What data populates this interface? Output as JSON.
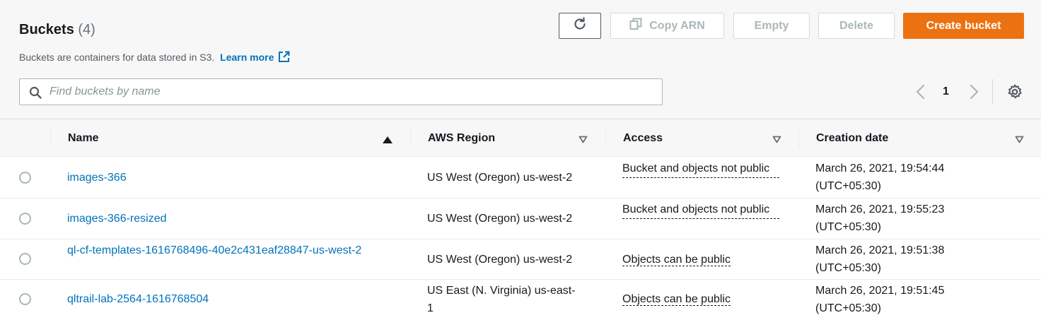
{
  "header": {
    "title": "Buckets",
    "count": "(4)",
    "description": "Buckets are containers for data stored in S3.",
    "learn_more": "Learn more"
  },
  "actions": {
    "copy_arn": "Copy ARN",
    "empty": "Empty",
    "delete": "Delete",
    "create_bucket": "Create bucket"
  },
  "search": {
    "placeholder": "Find buckets by name",
    "value": ""
  },
  "pagination": {
    "current_page": "1"
  },
  "table": {
    "columns": [
      "Name",
      "AWS Region",
      "Access",
      "Creation date"
    ],
    "rows": [
      {
        "name": "images-366",
        "region": "US West (Oregon) us-west-2",
        "access": "Bucket and objects not public",
        "created": "March 26, 2021, 19:54:44",
        "tz": "(UTC+05:30)"
      },
      {
        "name": "images-366-resized",
        "region": "US West (Oregon) us-west-2",
        "access": "Bucket and objects not public",
        "created": "March 26, 2021, 19:55:23",
        "tz": "(UTC+05:30)"
      },
      {
        "name": "ql-cf-templates-1616768496-40e2c431eaf28847-us-west-2",
        "region": "US West (Oregon) us-west-2",
        "access": "Objects can be public",
        "created": "March 26, 2021, 19:51:38",
        "tz": "(UTC+05:30)"
      },
      {
        "name": "qltrail-lab-2564-1616768504",
        "region": "US East (N. Virginia) us-east-1",
        "access": "Objects can be public",
        "created": "March 26, 2021, 19:51:45",
        "tz": "(UTC+05:30)"
      }
    ]
  },
  "colors": {
    "primary": "#ec7211",
    "link": "#0073bb",
    "text": "#16191f",
    "muted": "#687078"
  }
}
